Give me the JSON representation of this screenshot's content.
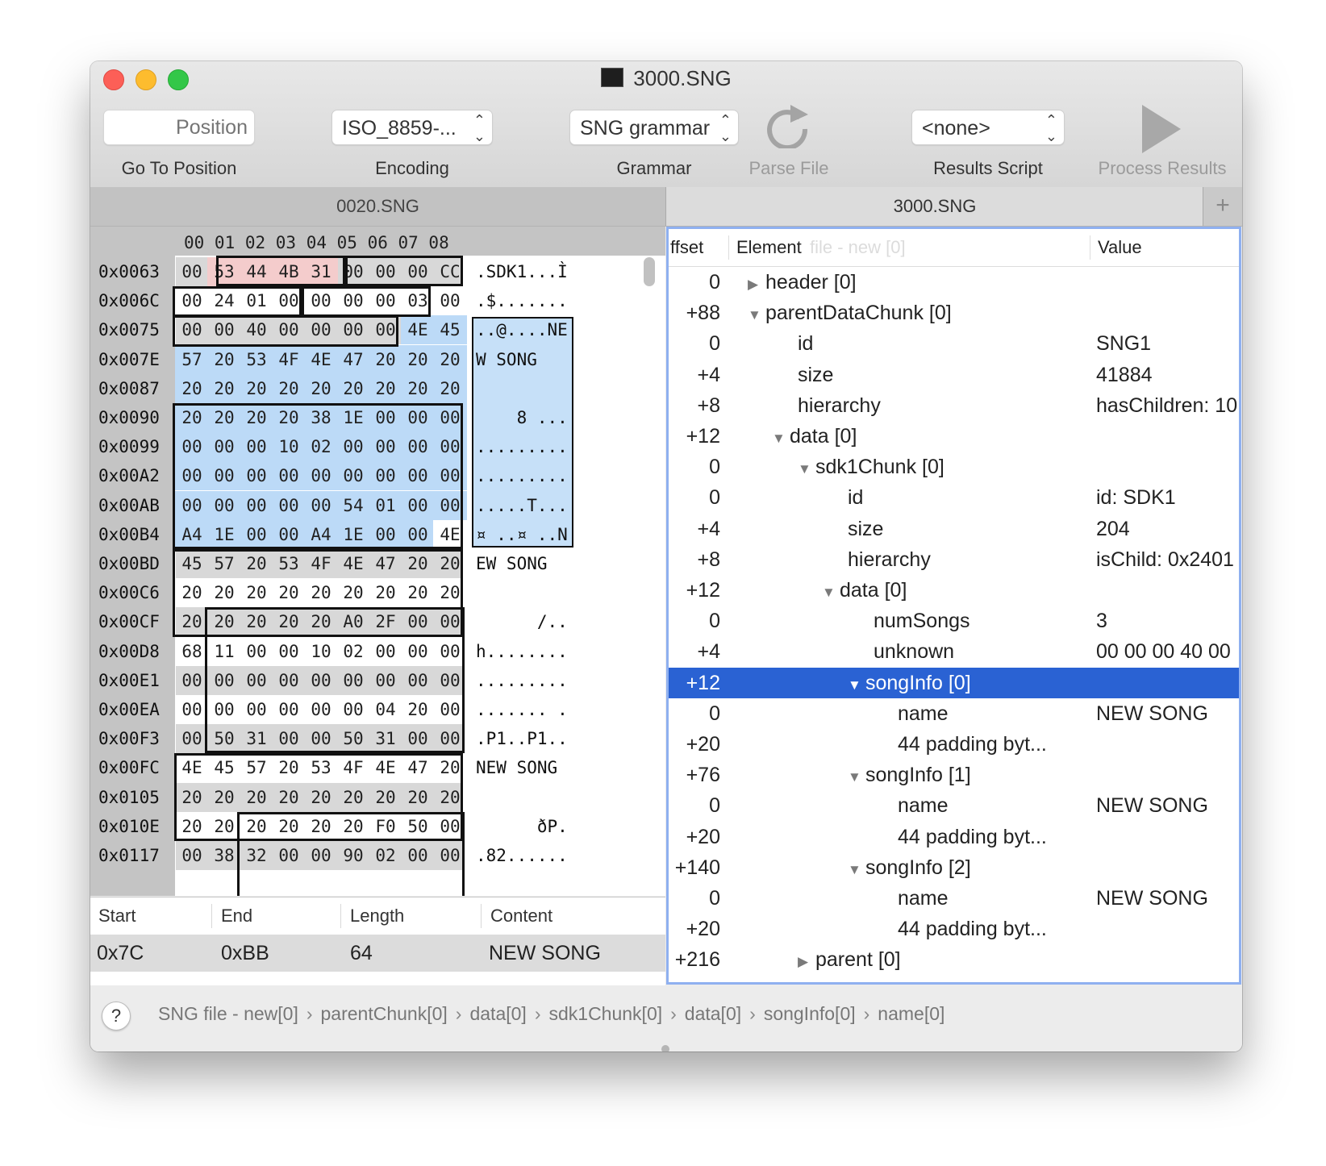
{
  "window": {
    "title": "3000.SNG"
  },
  "toolbar": {
    "position_placeholder": "Position",
    "position_label": "Go To Position",
    "encoding_value": "ISO_8859-...",
    "encoding_label": "Encoding",
    "grammar_value": "SNG grammar",
    "grammar_label": "Grammar",
    "parse_label": "Parse File",
    "results_script_value": "<none>",
    "results_script_label": "Results Script",
    "process_label": "Process Results"
  },
  "tabs": [
    {
      "label": "0020.SNG",
      "active": false
    },
    {
      "label": "3000.SNG",
      "active": true
    }
  ],
  "hex": {
    "column_headers": "00 01 02 03 04 05 06 07 08",
    "rows": [
      {
        "addr": "0x0063",
        "bytes": [
          "00",
          "53",
          "44",
          "4B",
          "31",
          "00",
          "00",
          "00",
          "CC"
        ],
        "ascii": ".SDK1...Ì"
      },
      {
        "addr": "0x006C",
        "bytes": [
          "00",
          "24",
          "01",
          "00",
          "00",
          "00",
          "00",
          "03",
          "00"
        ],
        "ascii": ".$......."
      },
      {
        "addr": "0x0075",
        "bytes": [
          "00",
          "00",
          "40",
          "00",
          "00",
          "00",
          "00",
          "4E",
          "45"
        ],
        "ascii": "..@....NE"
      },
      {
        "addr": "0x007E",
        "bytes": [
          "57",
          "20",
          "53",
          "4F",
          "4E",
          "47",
          "20",
          "20",
          "20"
        ],
        "ascii": "W SONG   "
      },
      {
        "addr": "0x0087",
        "bytes": [
          "20",
          "20",
          "20",
          "20",
          "20",
          "20",
          "20",
          "20",
          "20"
        ],
        "ascii": "         "
      },
      {
        "addr": "0x0090",
        "bytes": [
          "20",
          "20",
          "20",
          "20",
          "38",
          "1E",
          "00",
          "00",
          "00"
        ],
        "ascii": "    8 ..."
      },
      {
        "addr": "0x0099",
        "bytes": [
          "00",
          "00",
          "00",
          "10",
          "02",
          "00",
          "00",
          "00",
          "00"
        ],
        "ascii": "........."
      },
      {
        "addr": "0x00A2",
        "bytes": [
          "00",
          "00",
          "00",
          "00",
          "00",
          "00",
          "00",
          "00",
          "00"
        ],
        "ascii": "........."
      },
      {
        "addr": "0x00AB",
        "bytes": [
          "00",
          "00",
          "00",
          "00",
          "00",
          "54",
          "01",
          "00",
          "00"
        ],
        "ascii": ".....T..."
      },
      {
        "addr": "0x00B4",
        "bytes": [
          "A4",
          "1E",
          "00",
          "00",
          "A4",
          "1E",
          "00",
          "00",
          "4E"
        ],
        "ascii": "¤ ..¤ ..N"
      },
      {
        "addr": "0x00BD",
        "bytes": [
          "45",
          "57",
          "20",
          "53",
          "4F",
          "4E",
          "47",
          "20",
          "20"
        ],
        "ascii": "EW SONG  "
      },
      {
        "addr": "0x00C6",
        "bytes": [
          "20",
          "20",
          "20",
          "20",
          "20",
          "20",
          "20",
          "20",
          "20"
        ],
        "ascii": "         "
      },
      {
        "addr": "0x00CF",
        "bytes": [
          "20",
          "20",
          "20",
          "20",
          "20",
          "A0",
          "2F",
          "00",
          "00"
        ],
        "ascii": "      /.."
      },
      {
        "addr": "0x00D8",
        "bytes": [
          "68",
          "11",
          "00",
          "00",
          "10",
          "02",
          "00",
          "00",
          "00"
        ],
        "ascii": "h........"
      },
      {
        "addr": "0x00E1",
        "bytes": [
          "00",
          "00",
          "00",
          "00",
          "00",
          "00",
          "00",
          "00",
          "00"
        ],
        "ascii": "........."
      },
      {
        "addr": "0x00EA",
        "bytes": [
          "00",
          "00",
          "00",
          "00",
          "00",
          "00",
          "04",
          "20",
          "00"
        ],
        "ascii": "....... ."
      },
      {
        "addr": "0x00F3",
        "bytes": [
          "00",
          "50",
          "31",
          "00",
          "00",
          "50",
          "31",
          "00",
          "00"
        ],
        "ascii": ".P1..P1.."
      },
      {
        "addr": "0x00FC",
        "bytes": [
          "4E",
          "45",
          "57",
          "20",
          "53",
          "4F",
          "4E",
          "47",
          "20"
        ],
        "ascii": "NEW SONG "
      },
      {
        "addr": "0x0105",
        "bytes": [
          "20",
          "20",
          "20",
          "20",
          "20",
          "20",
          "20",
          "20",
          "20"
        ],
        "ascii": "         "
      },
      {
        "addr": "0x010E",
        "bytes": [
          "20",
          "20",
          "20",
          "20",
          "20",
          "20",
          "F0",
          "50",
          "00"
        ],
        "ascii": "      ðP."
      },
      {
        "addr": "0x0117",
        "bytes": [
          "00",
          "38",
          "32",
          "00",
          "00",
          "90",
          "02",
          "00",
          "00"
        ],
        "ascii": ".82......"
      }
    ]
  },
  "results": {
    "headers": [
      "Start",
      "End",
      "Length",
      "Content"
    ],
    "row": [
      "0x7C",
      "0xBB",
      "64",
      "NEW SONG"
    ]
  },
  "tree": {
    "headers": {
      "offset": "ffset",
      "element": "Element",
      "value": "Value",
      "ghost": "file - new [0]"
    },
    "rows": [
      {
        "offset": "0",
        "element": "header [0]",
        "value": "",
        "depth": 0,
        "disclosure": "closed"
      },
      {
        "offset": "+88",
        "element": "parentDataChunk [0]",
        "value": "",
        "depth": 0,
        "disclosure": "open"
      },
      {
        "offset": "0",
        "element": "id",
        "value": "SNG1",
        "depth": 1,
        "disclosure": "none"
      },
      {
        "offset": "+4",
        "element": "size",
        "value": "41884",
        "depth": 1,
        "disclosure": "none"
      },
      {
        "offset": "+8",
        "element": "hierarchy",
        "value": "hasChildren: 10",
        "depth": 1,
        "disclosure": "none"
      },
      {
        "offset": "+12",
        "element": "data [0]",
        "value": "",
        "depth": 1,
        "disclosure": "open"
      },
      {
        "offset": "0",
        "element": "sdk1Chunk [0]",
        "value": "",
        "depth": 2,
        "disclosure": "open"
      },
      {
        "offset": "0",
        "element": "id",
        "value": "id: SDK1",
        "depth": 3,
        "disclosure": "none"
      },
      {
        "offset": "+4",
        "element": "size",
        "value": "204",
        "depth": 3,
        "disclosure": "none"
      },
      {
        "offset": "+8",
        "element": "hierarchy",
        "value": "isChild: 0x2401",
        "depth": 3,
        "disclosure": "none"
      },
      {
        "offset": "+12",
        "element": "data [0]",
        "value": "",
        "depth": 3,
        "disclosure": "open"
      },
      {
        "offset": "0",
        "element": "numSongs",
        "value": "3",
        "depth": 4,
        "disclosure": "none"
      },
      {
        "offset": "+4",
        "element": "unknown",
        "value": "00 00 00 40 00",
        "depth": 4,
        "disclosure": "none"
      },
      {
        "offset": "+12",
        "element": "songInfo [0]",
        "value": "",
        "depth": 4,
        "disclosure": "open",
        "selected": true
      },
      {
        "offset": "0",
        "element": "name",
        "value": "NEW SONG",
        "depth": 5,
        "disclosure": "none"
      },
      {
        "offset": "+20",
        "element": "44 padding byt...",
        "value": "",
        "depth": 5,
        "disclosure": "none"
      },
      {
        "offset": "+76",
        "element": "songInfo [1]",
        "value": "",
        "depth": 4,
        "disclosure": "open"
      },
      {
        "offset": "0",
        "element": "name",
        "value": "NEW SONG",
        "depth": 5,
        "disclosure": "none"
      },
      {
        "offset": "+20",
        "element": "44 padding byt...",
        "value": "",
        "depth": 5,
        "disclosure": "none"
      },
      {
        "offset": "+140",
        "element": "songInfo [2]",
        "value": "",
        "depth": 4,
        "disclosure": "open"
      },
      {
        "offset": "0",
        "element": "name",
        "value": "NEW SONG",
        "depth": 5,
        "disclosure": "none"
      },
      {
        "offset": "+20",
        "element": "44 padding byt...",
        "value": "",
        "depth": 5,
        "disclosure": "none"
      },
      {
        "offset": "+216",
        "element": "parent [0]",
        "value": "",
        "depth": 2,
        "disclosure": "closed"
      }
    ]
  },
  "breadcrumb": {
    "help_label": "?",
    "items": [
      "SNG file - new[0]",
      "parentChunk[0]",
      "data[0]",
      "sdk1Chunk[0]",
      "data[0]",
      "songInfo[0]",
      "name[0]"
    ]
  },
  "colors": {
    "selection": "#2a62d3",
    "highlight_blue": "#bcdaf7",
    "highlight_pink": "#f4cccc",
    "focus_ring": "#8fb0f0"
  }
}
